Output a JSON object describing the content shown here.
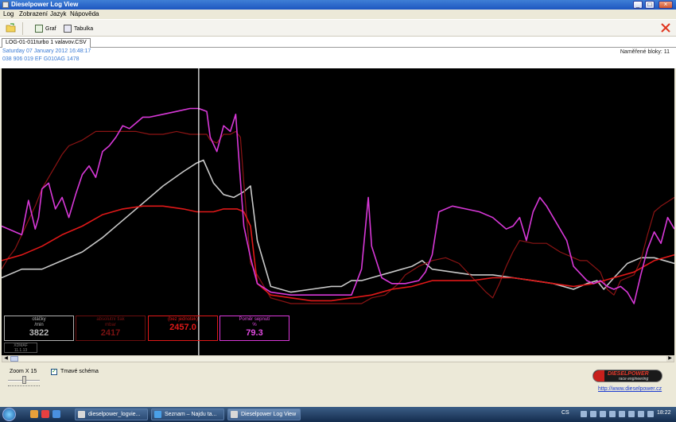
{
  "window": {
    "title": "Dieselpower Log View",
    "min": "_",
    "max": "□",
    "close": "×"
  },
  "menu": [
    "Log",
    "Zobrazení",
    "Jazyk",
    "Nápověda"
  ],
  "toolbar": {
    "graph_label": "Graf",
    "table_label": "Tabulka"
  },
  "tab": {
    "label": "LOG-01-011turbo 1 valavov.CSV"
  },
  "info": {
    "date": "Saturday 07 January 2012 16:48:17",
    "ecu": "038 906 019 EF  G010AG  1478",
    "blocks": "Naměřené bloky: 11"
  },
  "chart_data": {
    "type": "line",
    "xlim": [
      0,
      100
    ],
    "ylim": [
      0,
      100
    ],
    "cursor_x": 29.3,
    "series": [
      {
        "name": "otáčky",
        "color": "#c8c8c8",
        "x": [
          0,
          3,
          6,
          9,
          12,
          15,
          18,
          21,
          24,
          27,
          29,
          30,
          31.5,
          33,
          34.5,
          36,
          37,
          38,
          40,
          43,
          46,
          49,
          50.5,
          52,
          53.5,
          55,
          56.5,
          58,
          59.5,
          61,
          62.5,
          64,
          67,
          70,
          73,
          76,
          79,
          82,
          85,
          87,
          88.5,
          89.5,
          91,
          93,
          95,
          97,
          100
        ],
        "y": [
          27,
          30,
          30,
          33,
          36,
          41,
          47,
          53,
          59,
          64,
          67,
          68,
          60,
          56,
          55,
          57,
          59,
          40,
          24,
          22,
          23,
          24,
          24,
          26,
          26,
          27,
          28,
          29,
          30,
          31,
          33,
          30,
          29,
          28,
          28,
          27,
          26,
          25,
          23,
          25,
          26,
          23,
          27,
          32,
          34,
          34,
          32
        ]
      },
      {
        "name": "absolutní tlak",
        "color": "#8c1414",
        "x": [
          0,
          1,
          2,
          3,
          4,
          5,
          6,
          7,
          8,
          9,
          10,
          12,
          14,
          16,
          18,
          20,
          22,
          24,
          26,
          28,
          29.3,
          30.5,
          31,
          32,
          33,
          34,
          34.8,
          35.5,
          36,
          37,
          40,
          43,
          46,
          49,
          52,
          52.5,
          53.5,
          55,
          57,
          58,
          59,
          60,
          62,
          64,
          66,
          68,
          70,
          72,
          73,
          74,
          75,
          76,
          77,
          79,
          81,
          83,
          85,
          86,
          87,
          88,
          89,
          90,
          91,
          92,
          93,
          94,
          95,
          96,
          97,
          98,
          100
        ],
        "y": [
          30,
          34,
          37,
          42,
          47,
          52,
          58,
          62,
          66,
          70,
          73,
          75,
          78,
          78,
          78,
          78,
          77,
          77,
          78,
          77,
          77,
          77,
          75,
          74,
          77,
          77,
          78,
          76,
          60,
          32,
          20,
          18,
          18,
          18,
          18,
          18,
          18,
          20,
          21,
          23,
          25,
          28,
          31,
          33,
          34,
          32,
          27,
          22,
          20,
          25,
          31,
          36,
          40,
          39,
          39,
          36,
          34,
          33,
          33,
          31,
          29,
          23,
          21,
          26,
          27,
          28,
          33,
          42,
          50,
          52,
          55
        ]
      },
      {
        "name": "(bez jednotek)",
        "color": "#e01818",
        "x": [
          0,
          3,
          6,
          9,
          12,
          15,
          18,
          21,
          24,
          27,
          29,
          30,
          31.5,
          33,
          35,
          36,
          37,
          38,
          40,
          43,
          46,
          49,
          52,
          55,
          58,
          61,
          64,
          67,
          70,
          73,
          76,
          79,
          82,
          85,
          88,
          91,
          94,
          97,
          100
        ],
        "y": [
          33,
          35,
          38,
          42,
          45,
          49,
          51,
          52,
          52,
          51,
          50,
          50,
          50,
          51,
          51,
          50,
          45,
          25,
          21,
          20,
          19,
          19,
          20,
          21,
          23,
          24,
          26,
          26,
          26,
          27,
          27,
          26,
          25,
          24,
          25,
          27,
          29,
          33,
          35
        ]
      },
      {
        "name": "Poměr sepnutí",
        "color": "#d838d8",
        "x": [
          0,
          3,
          4,
          5,
          5.5,
          6,
          7,
          8,
          9,
          10,
          11,
          12,
          13,
          14,
          15,
          16,
          17,
          18,
          19,
          20,
          21,
          22,
          24,
          26,
          28,
          29.3,
          30.5,
          31,
          32,
          33,
          34,
          34.8,
          35.5,
          36,
          37,
          38,
          40,
          43,
          46,
          49,
          51,
          52,
          52.5,
          53.5,
          54.5,
          55,
          56.5,
          58,
          60,
          62,
          63,
          64,
          65,
          67,
          69,
          71,
          73,
          74,
          75,
          76,
          77,
          78,
          79,
          80,
          81,
          82,
          83,
          84,
          85,
          87,
          88,
          89,
          90,
          91,
          92,
          93,
          94,
          95,
          96,
          97,
          98,
          99,
          100
        ],
        "y": [
          45,
          42,
          54,
          44,
          48,
          58,
          60,
          51,
          55,
          48,
          56,
          63,
          66,
          62,
          71,
          73,
          76,
          80,
          79,
          81,
          83,
          83,
          84,
          85,
          86,
          86,
          85,
          76,
          71,
          80,
          78,
          84,
          61,
          45,
          34,
          25,
          22,
          21,
          21,
          21,
          21,
          21,
          24,
          30,
          55,
          38,
          27,
          25,
          25,
          26,
          29,
          35,
          50,
          52,
          51,
          50,
          48,
          46,
          44,
          45,
          48,
          40,
          50,
          55,
          52,
          48,
          44,
          40,
          31,
          26,
          25,
          26,
          24,
          23,
          24,
          22,
          18,
          28,
          37,
          43,
          39,
          48,
          44
        ]
      }
    ]
  },
  "readouts": [
    {
      "name": "otáčky",
      "unit": "/min",
      "value": "3822",
      "border": "#b0b0b0",
      "text": "#b8b8b8"
    },
    {
      "name": "absolutní tlak",
      "unit": "mbar",
      "value": "2417",
      "border": "#6a0e0e",
      "text": "#7a1212"
    },
    {
      "name": "(bez jednotek)",
      "unit": "",
      "value": "2457.0",
      "border": "#e01818",
      "text": "#e01818"
    },
    {
      "name": "Poměr sepnutí",
      "unit": "%",
      "value": "79.3",
      "border": "#d838d8",
      "text": "#e24ae2"
    }
  ],
  "cursor_small": {
    "line1": "XDMAF",
    "line2": "11.1.13"
  },
  "bottom": {
    "zoom_label": "Zoom X  15",
    "zoom_value": 15,
    "dark_label": "Tmavé schéma",
    "logo_top": "DIESELPOWER",
    "logo_bottom": "race engineering",
    "link": "http://www.dieselpower.cz"
  },
  "taskbar": {
    "tasks": [
      "dieselpower_logvie...",
      "Seznam – Najdu ta...",
      "Dieselpower Log View"
    ],
    "lang": "CS",
    "clock": "18:22"
  }
}
